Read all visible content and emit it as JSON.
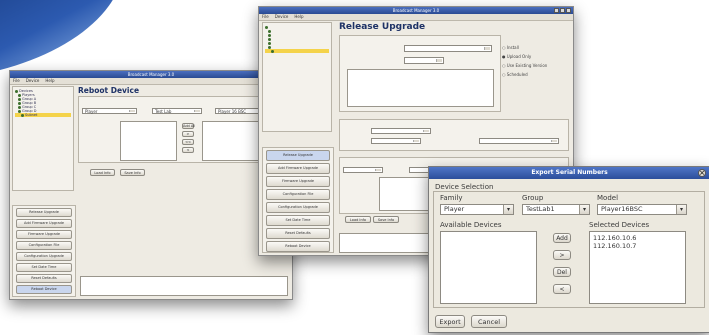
{
  "windows": {
    "reboot": {
      "title": "Broadcast Manager 3.0",
      "menu": [
        "File",
        "Device",
        "Help"
      ],
      "heading": "Reboot Device",
      "buttons": {
        "add_all": "Add All",
        "add": ">",
        "remove": "<",
        "remove_all": "<<",
        "load": "Load Info",
        "save": "Save Info"
      },
      "tree": [
        "Devices",
        "Players",
        "Group A",
        "Group B",
        "Group C",
        "Group D",
        "Subnet"
      ],
      "sidebar": [
        "Release Upgrade",
        "Add Firmware Upgrade",
        "Firmware Upgrade",
        "Configuration File",
        "Configuration Upgrade",
        "Set Date Time",
        "Reset Defaults",
        "Reboot Device"
      ],
      "filters": {
        "family": "Player",
        "group": "Test Lab",
        "model": "Player 16 BSC"
      }
    },
    "release": {
      "title": "Broadcast Manager 3.0",
      "menu": [
        "File",
        "Device",
        "Help"
      ],
      "heading": "Release Upgrade",
      "options": [
        "Install",
        "Upload Only",
        "Use Existing Version",
        "Scheduled"
      ],
      "sidebar": [
        "Release Upgrade",
        "Add Firmware Upgrade",
        "Firmware Upgrade",
        "Configuration File",
        "Configuration Upgrade",
        "Set Date Time",
        "Reset Defaults",
        "Reboot Device"
      ],
      "buttons": {
        "load": "Load Info",
        "save": "Save Info"
      }
    },
    "export": {
      "title": "Export Serial Numbers",
      "close_icon": "×",
      "section_label": "Device Selection",
      "family_label": "Family",
      "group_label": "Group",
      "model_label": "Model",
      "family_value": "Player",
      "group_value": "TestLab1",
      "model_value": "Player16BSC",
      "available_label": "Available Devices",
      "selected_label": "Selected Devices",
      "selected_devices": [
        "112.160.10.6",
        "112.160.10.7"
      ],
      "buttons": {
        "add_all": "Add",
        "add": ">",
        "remove_all": "Del",
        "remove": "<",
        "export": "Export",
        "cancel": "Cancel"
      }
    }
  }
}
